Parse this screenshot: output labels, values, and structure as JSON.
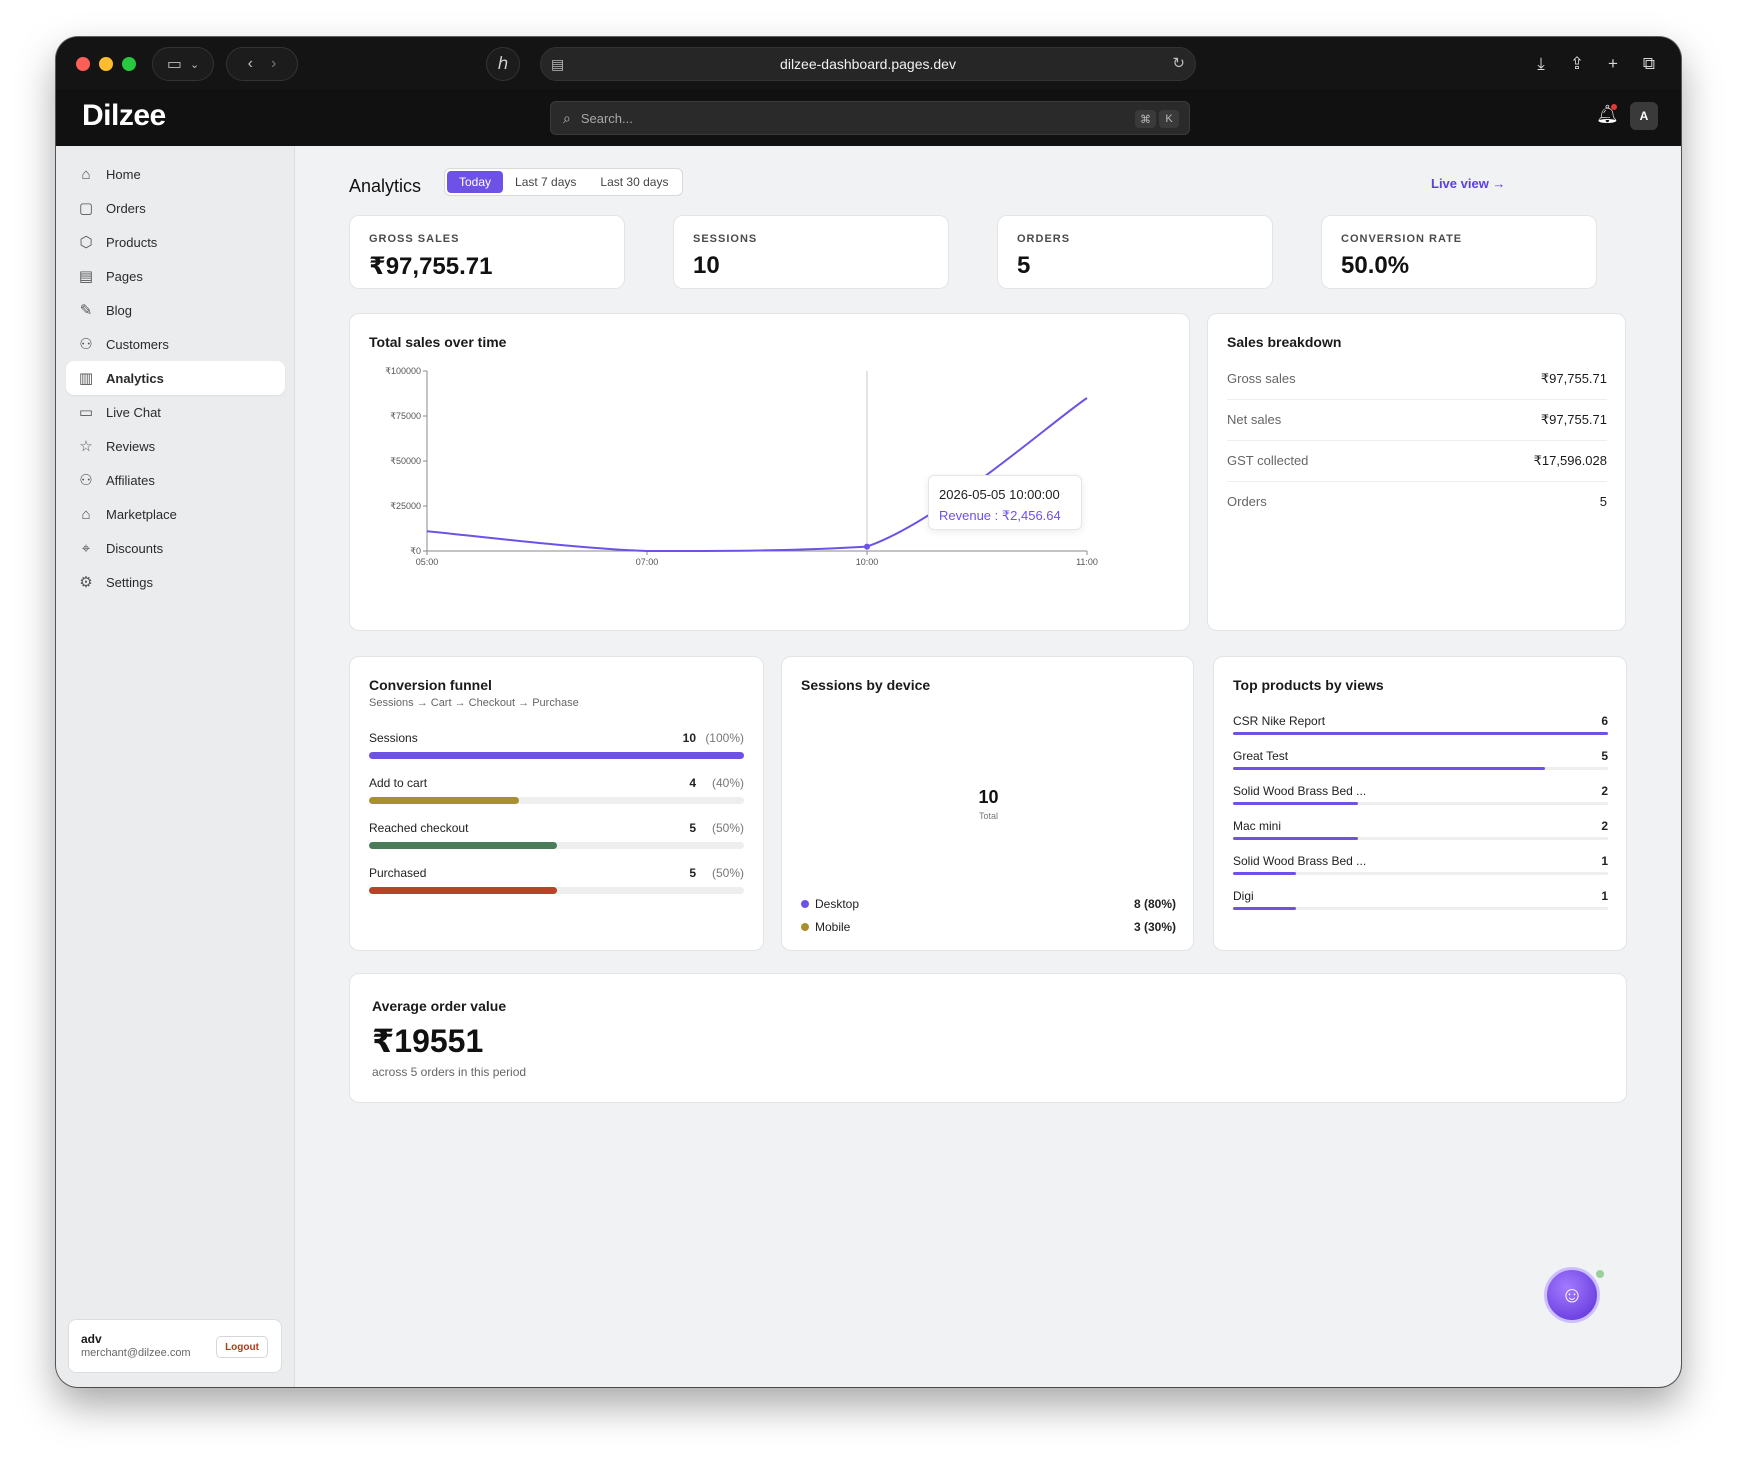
{
  "browser": {
    "url": "dilzee-dashboard.pages.dev"
  },
  "app": {
    "logo": "Dilzee",
    "search_placeholder": "Search...",
    "shortcut_key1": "⌘",
    "shortcut_key2": "K",
    "avatar_initial": "A"
  },
  "sidebar": {
    "items": [
      {
        "label": "Home",
        "icon": "home-icon"
      },
      {
        "label": "Orders",
        "icon": "orders-icon"
      },
      {
        "label": "Products",
        "icon": "products-icon"
      },
      {
        "label": "Pages",
        "icon": "pages-icon"
      },
      {
        "label": "Blog",
        "icon": "blog-icon"
      },
      {
        "label": "Customers",
        "icon": "customers-icon"
      },
      {
        "label": "Analytics",
        "icon": "analytics-icon",
        "active": true
      },
      {
        "label": "Live Chat",
        "icon": "chat-icon"
      },
      {
        "label": "Reviews",
        "icon": "star-icon"
      },
      {
        "label": "Affiliates",
        "icon": "affiliates-icon"
      },
      {
        "label": "Marketplace",
        "icon": "marketplace-icon"
      },
      {
        "label": "Discounts",
        "icon": "discounts-icon"
      },
      {
        "label": "Settings",
        "icon": "gear-icon"
      }
    ],
    "user": {
      "name": "adv",
      "email": "merchant@dilzee.com",
      "logout_label": "Logout"
    }
  },
  "header": {
    "title": "Analytics",
    "ranges": [
      "Today",
      "Last 7 days",
      "Last 30 days"
    ],
    "active_range": "Today",
    "live_view": "Live view →"
  },
  "stats": [
    {
      "label": "GROSS SALES",
      "value": "₹97,755.71"
    },
    {
      "label": "SESSIONS",
      "value": "10"
    },
    {
      "label": "ORDERS",
      "value": "5"
    },
    {
      "label": "CONVERSION RATE",
      "value": "50.0%"
    }
  ],
  "sales_chart": {
    "title": "Total sales over time",
    "tooltip_time": "2026-05-05 10:00:00",
    "tooltip_value": "Revenue : ₹2,456.64"
  },
  "chart_data": {
    "type": "line",
    "title": "Total sales over time",
    "x_ticks": [
      "05:00",
      "07:00",
      "10:00",
      "11:00"
    ],
    "y_ticks": [
      "₹100000",
      "₹75000",
      "₹50000",
      "₹25000",
      "₹0"
    ],
    "ylim": [
      0,
      100000
    ],
    "series": [
      {
        "points": [
          {
            "x": "05:00",
            "y": 11000
          },
          {
            "x": "07:00",
            "y": 0
          },
          {
            "x": "10:00",
            "y": 2456.64
          },
          {
            "x": "11:00",
            "y": 85000
          }
        ]
      }
    ]
  },
  "breakdown": {
    "title": "Sales breakdown",
    "rows": [
      {
        "label": "Gross sales",
        "value": "₹97,755.71"
      },
      {
        "label": "Net sales",
        "value": "₹97,755.71"
      },
      {
        "label": "GST collected",
        "value": "₹17,596.028"
      },
      {
        "label": "Orders",
        "value": "5"
      }
    ]
  },
  "funnel": {
    "title": "Conversion funnel",
    "subtitle": "Sessions → Cart → Checkout → Purchase",
    "steps": [
      {
        "label": "Sessions",
        "count": "10",
        "pct": "(100%)",
        "fraction": 1.0,
        "color": "#6e52e8"
      },
      {
        "label": "Add to cart",
        "count": "4",
        "pct": "(40%)",
        "fraction": 0.4,
        "color": "#a8902e"
      },
      {
        "label": "Reached checkout",
        "count": "5",
        "pct": "(50%)",
        "fraction": 0.5,
        "color": "#4a7c59"
      },
      {
        "label": "Purchased",
        "count": "5",
        "pct": "(50%)",
        "fraction": 0.5,
        "color": "#b5452a"
      }
    ]
  },
  "devices": {
    "title": "Sessions by device",
    "total": "10",
    "total_label": "Total",
    "rows": [
      {
        "name": "Desktop",
        "value": "8 (80%)",
        "color": "#6e52e8"
      },
      {
        "name": "Mobile",
        "value": "3 (30%)",
        "color": "#a8902e"
      }
    ]
  },
  "top_products": {
    "title": "Top products by views",
    "rows": [
      {
        "name": "CSR Nike Report",
        "value": "6",
        "fraction": 1.0
      },
      {
        "name": "Great Test",
        "value": "5",
        "fraction": 0.833
      },
      {
        "name": "Solid Wood Brass Bed ...",
        "value": "2",
        "fraction": 0.333
      },
      {
        "name": "Mac mini",
        "value": "2",
        "fraction": 0.333
      },
      {
        "name": "Solid Wood Brass Bed ...",
        "value": "1",
        "fraction": 0.167
      },
      {
        "name": "Digi",
        "value": "1",
        "fraction": 0.167
      }
    ]
  },
  "aov": {
    "title": "Average order value",
    "value": "₹19551",
    "subtitle": "across 5 orders in this period"
  }
}
